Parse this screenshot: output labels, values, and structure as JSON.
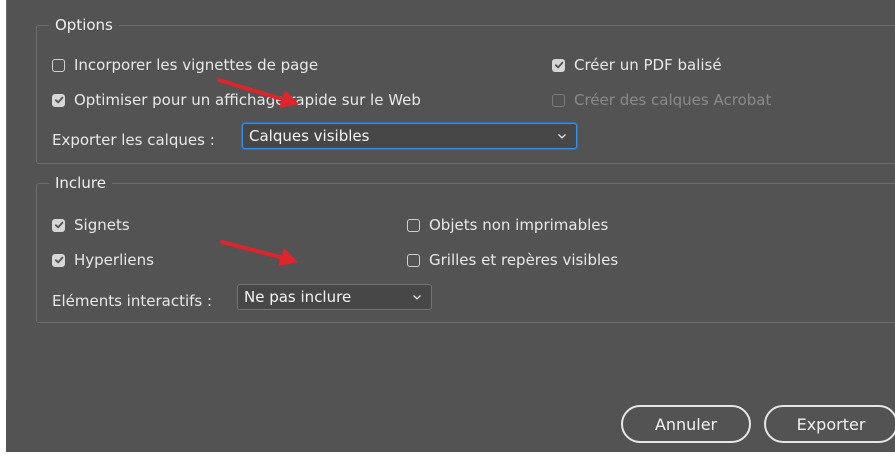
{
  "options": {
    "legend": "Options",
    "incorporer_vignettes": {
      "label": "Incorporer les vignettes de page",
      "checked": false
    },
    "creer_pdf_balise": {
      "label": "Créer un PDF balisé",
      "checked": true
    },
    "optimiser_web": {
      "label": "Optimiser pour un affichage rapide sur le Web",
      "checked": true
    },
    "creer_calques_acrobat": {
      "label": "Créer des calques Acrobat",
      "checked": false,
      "disabled": true
    },
    "exporter_calques": {
      "label": "Exporter les calques :",
      "value": "Calques visibles"
    }
  },
  "inclure": {
    "legend": "Inclure",
    "signets": {
      "label": "Signets",
      "checked": true
    },
    "hyperliens": {
      "label": "Hyperliens",
      "checked": true
    },
    "objets_non_imprimables": {
      "label": "Objets non imprimables",
      "checked": false
    },
    "grilles_reperes": {
      "label": "Grilles et repères visibles",
      "checked": false
    },
    "elements_interactifs": {
      "label": "Eléments interactifs :",
      "value": "Ne pas inclure"
    }
  },
  "buttons": {
    "annuler": "Annuler",
    "exporter": "Exporter"
  },
  "colors": {
    "panel_bg": "#535353",
    "annotation_arrow": "#e0242b",
    "focus_ring": "#3c8fe6"
  },
  "icons": [
    "checkbox-checked-icon",
    "checkbox-unchecked-icon",
    "chevron-down-icon",
    "red-arrow-annotation"
  ]
}
